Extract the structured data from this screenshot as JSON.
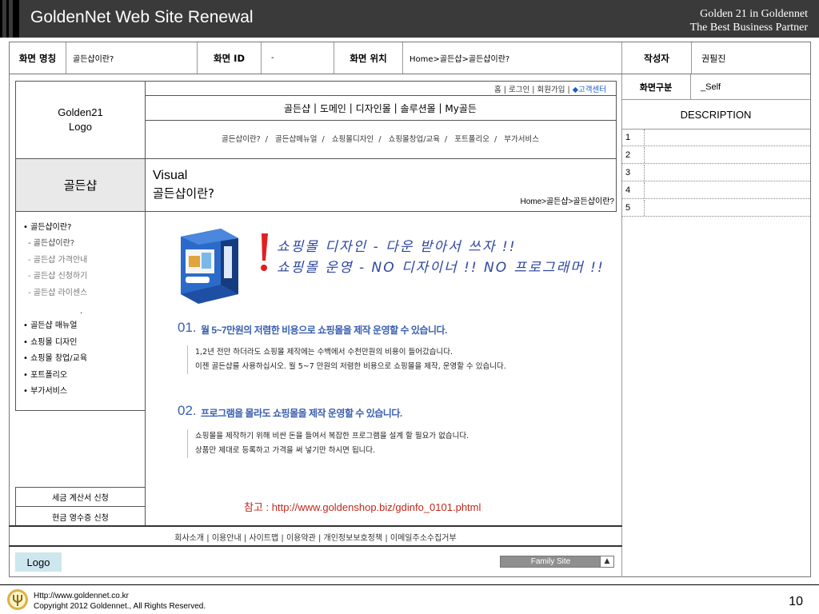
{
  "header": {
    "title": "GoldenNet Web Site Renewal",
    "tagline1": "Golden 21 in Goldennet",
    "tagline2": "The Best Business Partner"
  },
  "info": {
    "screen_name_label": "화면 명칭",
    "screen_name_value": "골든샵이란?",
    "screen_id_label": "화면 ID",
    "screen_id_value": "-",
    "screen_pos_label": "화면 위치",
    "screen_pos_value": "Home>골든샵>골든샵이란?",
    "author_label": "작성자",
    "author_value": "권필진"
  },
  "mockup": {
    "logo_line1": "Golden21",
    "logo_line2": "Logo",
    "util": {
      "home": "홈",
      "login": "로그인",
      "join": "회원가입",
      "cs": "◆고객센터",
      "sep": "|"
    },
    "gnb": [
      "골든샵",
      "도메인",
      "디자인몰",
      "솔루션몰",
      "My골든"
    ],
    "gnb_sep": "|",
    "sub_menu": [
      "골든샵이란?",
      "골든샵메뉴얼",
      "쇼핑몰디자인",
      "쇼핑몰창업/교육",
      "포트폴리오",
      "부가서비스"
    ],
    "sub_sep": "/",
    "side_title": "골든샵",
    "visual_line1": "Visual",
    "visual_line2": "골든샵이란?",
    "visual_crumb": "Home>골든샵>골든샵이란?",
    "side_menu": [
      "• 골든샵이란?",
      "- 골든샵이란?",
      "- 골든샵 가격안내",
      "- 골든샵 신청하기",
      "- 골든샵 라이센스",
      "• 골든샵 매뉴얼",
      "• 쇼핑몰 디자인",
      "• 쇼핑몰 창업/교육",
      "• 포트폴리오",
      "• 부가서비스"
    ],
    "side_dot": ".",
    "tax_invoice": "세금 계산서 신청",
    "cash_receipt": "현금 영수증 신청",
    "reference": "참고 : http://www.goldenshop.biz/gdinfo_0101.phtml",
    "footer_links": [
      "회사소개",
      "이용안내",
      "사이트맵",
      "이용약관",
      "개인정보보호정책",
      "이메일주소수집거부"
    ],
    "footer_sep": "|",
    "logo_button": "Logo",
    "family_site": "Family Site",
    "family_arrow": "▲"
  },
  "content": {
    "handwriting1": "쇼핑몰 디자인 - 다운 받아서 쓰자 !!",
    "handwriting2": "쇼핑몰 운영 - NO 디자이너 !! NO 프로그래머 !!",
    "s1_num": "01.",
    "s1_title": "월 5~7만원의 저렴한 비용으로 쇼핑몰을 제작 운영할 수 있습니다.",
    "s1_p1": "1,2년 전만 하더라도 쇼핑몰 제작에는 수백에서 수천만원의 비용이 들어갔습니다.",
    "s1_p2": "이젠 골든샵를 사용하십시오. 월 5~7 만원의 저렴한 비용으로 쇼핑몰을 제작, 운영할 수 있습니다.",
    "s2_num": "02.",
    "s2_title": "프로그램을 몰라도 쇼핑몰을 제작 운영할 수 있습니다.",
    "s2_p1": "쇼핑몰을 제작하기 위해 비싼 돈을 들여서 복잡한 프로그램을 설계 할 필요가 없습니다.",
    "s2_p2": "상품만 제대로 등록하고 가격을 써 넣기만 하시면 됩니다."
  },
  "description": {
    "type_label": "화면구분",
    "type_value": "_Self",
    "title": "DESCRIPTION",
    "rows": [
      "1",
      "2",
      "3",
      "4",
      "5"
    ]
  },
  "bottom": {
    "url": "Http://www.goldennet.co.kr",
    "copyright": "Copyright 2012 Goldennet., All Rights Reserved.",
    "page": "10"
  },
  "colors": {
    "header_bg": "#3a3a3a",
    "accent_blue": "#3a5fb0",
    "reference_red": "#c0281a",
    "logo_button_bg": "#cde7ee"
  }
}
